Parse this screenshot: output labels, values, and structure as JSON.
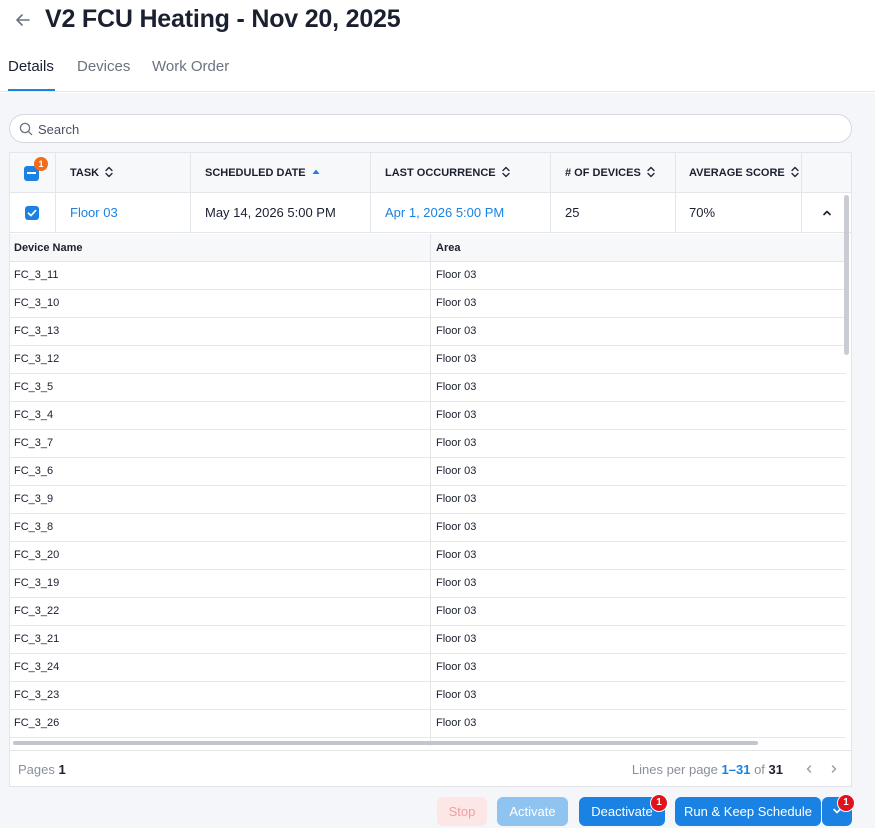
{
  "header": {
    "title": "V2 FCU Heating - Nov 20, 2025"
  },
  "tabs": [
    {
      "label": "Details"
    },
    {
      "label": "Devices"
    },
    {
      "label": "Work Order"
    }
  ],
  "search": {
    "placeholder": "Search",
    "value": ""
  },
  "table": {
    "selected_count": "1",
    "columns": [
      {
        "label": "TASK"
      },
      {
        "label": "SCHEDULED DATE"
      },
      {
        "label": "LAST OCCURRENCE"
      },
      {
        "label": "# OF DEVICES"
      },
      {
        "label": "AVERAGE SCORE"
      }
    ],
    "row": {
      "task": "Floor 03",
      "scheduled_date": "May 14, 2026 5:00 PM",
      "last_occurrence": "Apr 1, 2026 5:00 PM",
      "devices": "25",
      "average_score": "70%"
    },
    "sub_table": {
      "columns": [
        {
          "label": "Device Name"
        },
        {
          "label": "Area"
        }
      ],
      "rows": [
        {
          "device": "FC_3_11",
          "area": "Floor 03"
        },
        {
          "device": "FC_3_10",
          "area": "Floor 03"
        },
        {
          "device": "FC_3_13",
          "area": "Floor 03"
        },
        {
          "device": "FC_3_12",
          "area": "Floor 03"
        },
        {
          "device": "FC_3_5",
          "area": "Floor 03"
        },
        {
          "device": "FC_3_4",
          "area": "Floor 03"
        },
        {
          "device": "FC_3_7",
          "area": "Floor 03"
        },
        {
          "device": "FC_3_6",
          "area": "Floor 03"
        },
        {
          "device": "FC_3_9",
          "area": "Floor 03"
        },
        {
          "device": "FC_3_8",
          "area": "Floor 03"
        },
        {
          "device": "FC_3_20",
          "area": "Floor 03"
        },
        {
          "device": "FC_3_19",
          "area": "Floor 03"
        },
        {
          "device": "FC_3_22",
          "area": "Floor 03"
        },
        {
          "device": "FC_3_21",
          "area": "Floor 03"
        },
        {
          "device": "FC_3_24",
          "area": "Floor 03"
        },
        {
          "device": "FC_3_23",
          "area": "Floor 03"
        },
        {
          "device": "FC_3_26",
          "area": "Floor 03"
        }
      ]
    },
    "footer": {
      "pages_label": "Pages",
      "pages_value": "1",
      "lines_label": "Lines per page",
      "lines_range": "1–31",
      "of_label": "of",
      "total": "31"
    }
  },
  "actions": {
    "stop": "Stop",
    "activate": "Activate",
    "deactivate": "Deactivate",
    "deactivate_badge": "1",
    "run": "Run & Keep Schedule",
    "split_badge": "1"
  },
  "colors": {
    "accent": "#1a82e2",
    "badge_orange": "#f26b1d",
    "badge_red": "#e0121b"
  },
  "icons": [
    "back-arrow-icon",
    "search-icon",
    "sort-icon",
    "sort-asc-icon",
    "check-icon",
    "chevron-up-icon",
    "chevron-left-icon",
    "chevron-right-icon",
    "chevron-down-icon"
  ]
}
